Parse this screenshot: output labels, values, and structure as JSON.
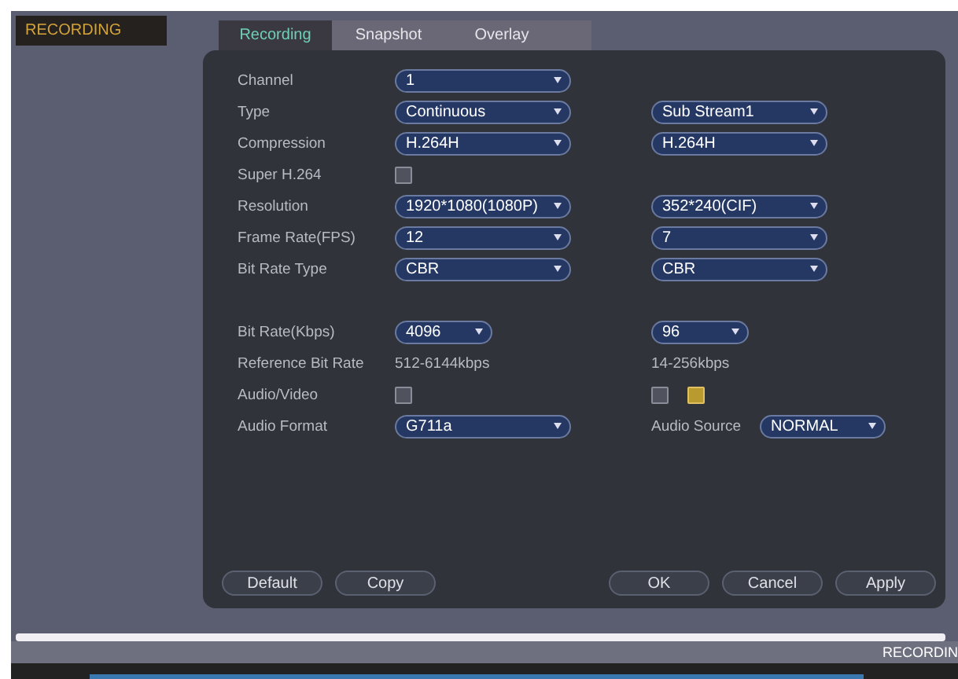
{
  "sidebar": {
    "title": "RECORDING"
  },
  "tabs": [
    {
      "label": "Recording",
      "selected": true
    },
    {
      "label": "Snapshot",
      "selected": false
    },
    {
      "label": "Overlay",
      "selected": false
    }
  ],
  "sections": [
    [
      {
        "label": "Channel",
        "main": [
          {
            "kind": "select",
            "value": "1"
          }
        ]
      },
      {
        "label": "Type",
        "main": [
          {
            "kind": "select",
            "value": "Continuous"
          }
        ],
        "sub": [
          {
            "kind": "select",
            "value": "Sub Stream1"
          }
        ]
      },
      {
        "label": "Compression",
        "main": [
          {
            "kind": "select",
            "value": "H.264H"
          }
        ],
        "sub": [
          {
            "kind": "select",
            "value": "H.264H"
          }
        ]
      },
      {
        "label": "Super H.264",
        "main": [
          {
            "kind": "checkbox",
            "checked": false
          }
        ]
      },
      {
        "label": "Resolution",
        "main": [
          {
            "kind": "select",
            "value": "1920*1080(1080P)"
          }
        ],
        "sub": [
          {
            "kind": "select",
            "value": "352*240(CIF)"
          }
        ]
      },
      {
        "label": "Frame Rate(FPS)",
        "main": [
          {
            "kind": "select",
            "value": "12"
          }
        ],
        "sub": [
          {
            "kind": "select",
            "value": "7"
          }
        ]
      },
      {
        "label": "Bit Rate Type",
        "main": [
          {
            "kind": "select",
            "value": "CBR"
          }
        ],
        "sub": [
          {
            "kind": "select",
            "value": "CBR"
          }
        ]
      }
    ],
    [
      {
        "label": "Bit Rate(Kbps)",
        "main": [
          {
            "kind": "short-select",
            "value": "4096"
          }
        ],
        "sub": [
          {
            "kind": "short-select",
            "value": "96"
          }
        ]
      },
      {
        "label": "Reference Bit Rate",
        "main": [
          {
            "kind": "text",
            "text": "512-6144kbps"
          }
        ],
        "sub": [
          {
            "kind": "text",
            "text": "14-256kbps"
          }
        ]
      },
      {
        "label": "Audio/Video",
        "main": [
          {
            "kind": "checkbox",
            "checked": false
          }
        ],
        "sub": [
          {
            "kind": "checkbox",
            "checked": false
          },
          {
            "kind": "checkbox",
            "checked": true
          }
        ]
      },
      {
        "label": "Audio Format",
        "main": [
          {
            "kind": "select",
            "value": "G711a"
          }
        ],
        "sub": [
          {
            "kind": "label",
            "text": "Audio Source"
          },
          {
            "kind": "mid-select",
            "value": "NORMAL"
          }
        ]
      }
    ]
  ],
  "left_buttons": [
    "Default",
    "Copy"
  ],
  "right_buttons": [
    "OK",
    "Cancel",
    "Apply"
  ],
  "status_bar": {
    "text": "RECORDIN"
  }
}
